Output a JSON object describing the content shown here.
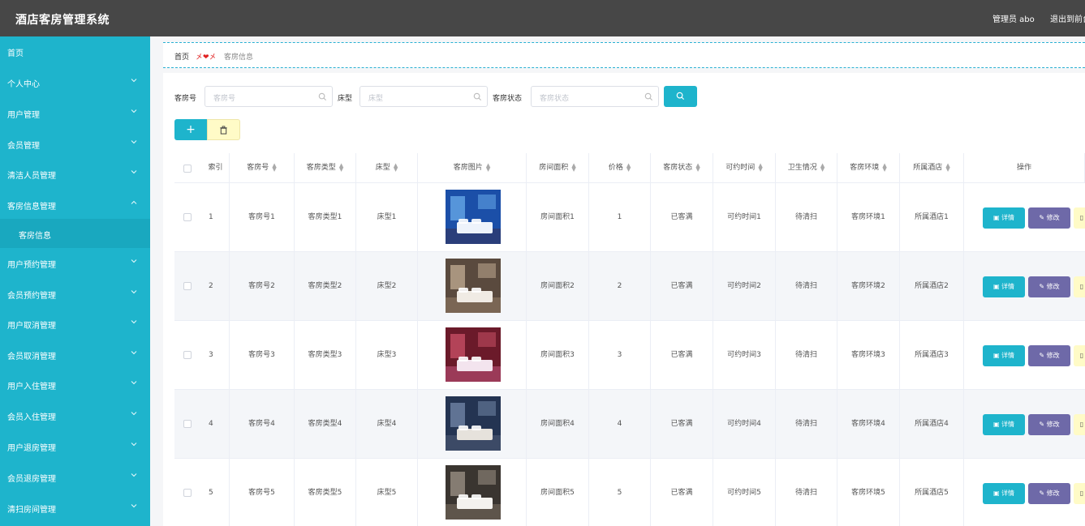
{
  "header": {
    "title": "酒店客房管理系统",
    "user": "管理员 abo",
    "logout": "退出到前台"
  },
  "sidebar": {
    "items": [
      {
        "label": "首页",
        "chevron": ""
      },
      {
        "label": "个人中心",
        "chevron": "down"
      },
      {
        "label": "用户管理",
        "chevron": "down"
      },
      {
        "label": "会员管理",
        "chevron": "down"
      },
      {
        "label": "清洁人员管理",
        "chevron": "down"
      },
      {
        "label": "客房信息管理",
        "chevron": "up"
      },
      {
        "label": "用户预约管理",
        "chevron": "down"
      },
      {
        "label": "会员预约管理",
        "chevron": "down"
      },
      {
        "label": "用户取消管理",
        "chevron": "down"
      },
      {
        "label": "会员取消管理",
        "chevron": "down"
      },
      {
        "label": "用户入住管理",
        "chevron": "down"
      },
      {
        "label": "会员入住管理",
        "chevron": "down"
      },
      {
        "label": "用户退房管理",
        "chevron": "down"
      },
      {
        "label": "会员退房管理",
        "chevron": "down"
      },
      {
        "label": "清扫房间管理",
        "chevron": "down"
      }
    ],
    "submenu": "客房信息"
  },
  "breadcrumb": {
    "home": "首页",
    "separator": "❤",
    "current": "客房信息"
  },
  "search": {
    "room_no_label": "客房号",
    "room_no_placeholder": "客房号",
    "bed_label": "床型",
    "bed_placeholder": "床型",
    "status_label": "客房状态",
    "status_placeholder": "客房状态"
  },
  "buttons": {
    "add": "+",
    "detail": "详情",
    "edit": "修改"
  },
  "table": {
    "headers": [
      "索引",
      "客房号",
      "客房类型",
      "床型",
      "客房图片",
      "房间面积",
      "价格",
      "客房状态",
      "可约时间",
      "卫生情况",
      "客房环境",
      "所属酒店",
      "操作"
    ],
    "rows": [
      {
        "index": "1",
        "room_no": "客房号1",
        "room_type": "客房类型1",
        "bed": "床型1",
        "area": "房间面积1",
        "price": "1",
        "status": "已客满",
        "time": "可约时间1",
        "hygiene": "待清扫",
        "env": "客房环境1",
        "hotel": "所属酒店1"
      },
      {
        "index": "2",
        "room_no": "客房号2",
        "room_type": "客房类型2",
        "bed": "床型2",
        "area": "房间面积2",
        "price": "2",
        "status": "已客满",
        "time": "可约时间2",
        "hygiene": "待清扫",
        "env": "客房环境2",
        "hotel": "所属酒店2"
      },
      {
        "index": "3",
        "room_no": "客房号3",
        "room_type": "客房类型3",
        "bed": "床型3",
        "area": "房间面积3",
        "price": "3",
        "status": "已客满",
        "time": "可约时间3",
        "hygiene": "待清扫",
        "env": "客房环境3",
        "hotel": "所属酒店3"
      },
      {
        "index": "4",
        "room_no": "客房号4",
        "room_type": "客房类型4",
        "bed": "床型4",
        "area": "房间面积4",
        "price": "4",
        "status": "已客满",
        "time": "可约时间4",
        "hygiene": "待清扫",
        "env": "客房环境4",
        "hotel": "所属酒店4"
      },
      {
        "index": "5",
        "room_no": "客房号5",
        "room_type": "客房类型5",
        "bed": "床型5",
        "area": "房间面积5",
        "price": "5",
        "status": "已客满",
        "time": "可约时间5",
        "hygiene": "待清扫",
        "env": "客房环境5",
        "hotel": "所属酒店5"
      }
    ]
  },
  "colors": {
    "accent": "#1eb4cc",
    "topbar": "#474747",
    "edit": "#6e69a8",
    "delete": "#fffbc7"
  }
}
